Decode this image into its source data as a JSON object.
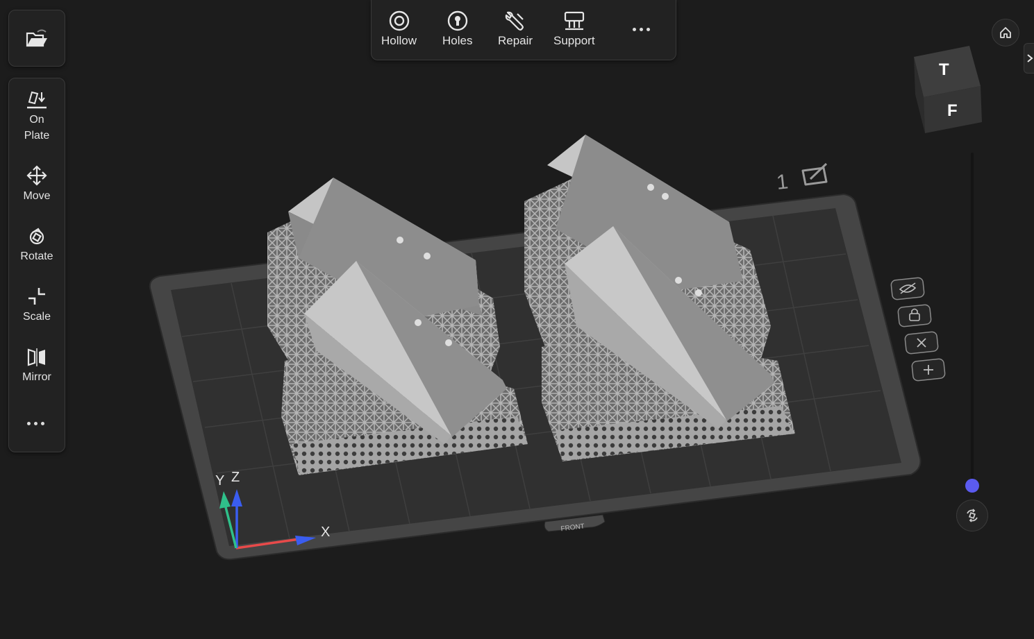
{
  "left_toolbar": {
    "items": [
      {
        "id": "on-plate",
        "label_line1": "On",
        "label_line2": "Plate",
        "icon": "on-plate-icon"
      },
      {
        "id": "move",
        "label": "Move",
        "icon": "move-icon"
      },
      {
        "id": "rotate",
        "label": "Rotate",
        "icon": "rotate-icon"
      },
      {
        "id": "scale",
        "label": "Scale",
        "icon": "scale-icon"
      },
      {
        "id": "mirror",
        "label": "Mirror",
        "icon": "mirror-icon"
      }
    ],
    "more_icon": "more-dots-icon",
    "open_icon": "folder-open-icon"
  },
  "top_toolbar": {
    "items": [
      {
        "id": "hollow",
        "label": "Hollow",
        "icon": "hollow-icon"
      },
      {
        "id": "holes",
        "label": "Holes",
        "icon": "holes-icon"
      },
      {
        "id": "repair",
        "label": "Repair",
        "icon": "wrench-icon"
      },
      {
        "id": "support",
        "label": "Support",
        "icon": "support-icon"
      }
    ],
    "more_icon": "more-dots-icon"
  },
  "view_cube": {
    "top_face": "T",
    "front_face": "F"
  },
  "plate": {
    "number": "1",
    "front_label": "FRONT"
  },
  "axes": {
    "x": "X",
    "y": "Y",
    "z": "Z"
  },
  "colors": {
    "accent": "#5b5bf0",
    "axis_x": "#e84a4a",
    "axis_y": "#2fc08a",
    "axis_z": "#3a5df0",
    "model": "#9a9a9a"
  },
  "right_controls": [
    "eye-slash-icon",
    "lock-icon",
    "close-icon",
    "plus-icon"
  ]
}
